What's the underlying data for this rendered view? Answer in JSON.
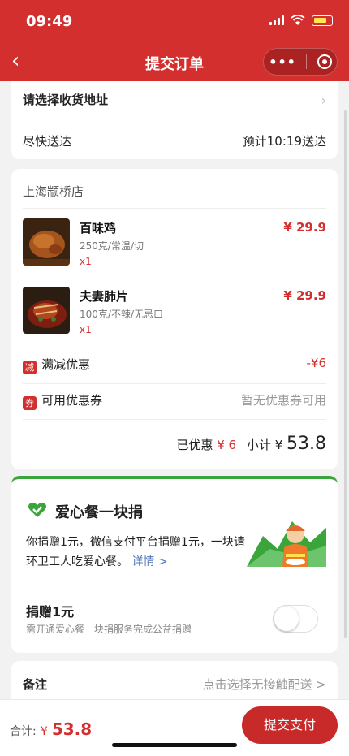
{
  "status": {
    "time": "09:49"
  },
  "nav": {
    "title": "提交订单",
    "back_icon": "‹",
    "more_label": "•••"
  },
  "delivery": {
    "address_label": "请选择收货地址",
    "time_label": "尽快送达",
    "eta": "预计10:19送达"
  },
  "store": {
    "name": "上海颛桥店",
    "items": [
      {
        "name": "百味鸡",
        "spec": "250克/常温/切",
        "qty": "x1",
        "price": "¥ 29.9"
      },
      {
        "name": "夫妻肺片",
        "spec": "100克/不辣/无忌口",
        "qty": "x1",
        "price": "¥ 29.9"
      }
    ],
    "discount": {
      "tag": "减",
      "label": "满减优惠",
      "value": "-¥6"
    },
    "coupon": {
      "tag": "券",
      "label": "可用优惠券",
      "value": "暂无优惠券可用"
    },
    "summary": {
      "saved_label": "已优惠",
      "saved_value": "¥ 6",
      "subtotal_label": "小计",
      "subtotal_currency": "¥",
      "subtotal_value": "53.8"
    }
  },
  "charity": {
    "title": "爱心餐一块捐",
    "description": "你捐赠1元，微信支付平台捐赠1元，一块请环卫工人吃爱心餐。",
    "details_link": "详情 >",
    "donate_title": "捐赠1元",
    "donate_desc": "需开通爱心餐一块捐服务完成公益捐赠",
    "donate_enabled": false
  },
  "remark": {
    "label": "备注",
    "value": "点击选择无接触配送 >"
  },
  "footer": {
    "total_label": "合计:",
    "total_currency": "¥",
    "total_value": "53.8",
    "pay_button": "提交支付"
  },
  "colors": {
    "primary": "#d42f2f",
    "green": "#3aa53a"
  }
}
